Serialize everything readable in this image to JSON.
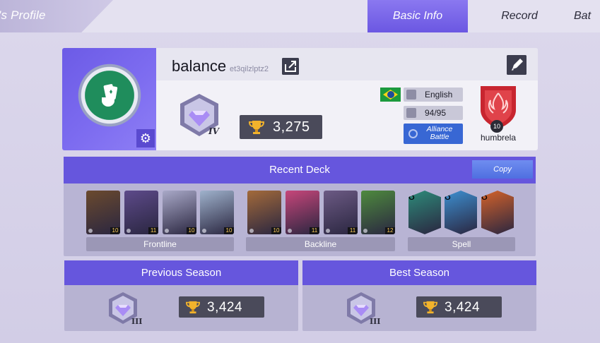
{
  "header": {
    "title": "'s Profile",
    "tabs": [
      {
        "label": "Basic Info",
        "active": true
      },
      {
        "label": "Record",
        "active": false
      },
      {
        "label": "Bat",
        "active": false
      }
    ]
  },
  "profile": {
    "name": "balance",
    "id": "et3qilzlptz2",
    "rank_tier": "IV",
    "trophies": "3,275",
    "language": "English",
    "level_progress": "94/95",
    "alliance_label": "Alliance Battle",
    "guild_level": "10",
    "guild_name": "humbrela",
    "colors": {
      "accent": "#6656dd",
      "flag_green": "#1c9a3d",
      "alliance_blue": "#3867d4"
    }
  },
  "recent_deck": {
    "title": "Recent Deck",
    "copy_label": "Copy",
    "groups": [
      {
        "label": "Frontline",
        "cards": [
          {
            "name": "bear-hero",
            "level": "10",
            "color": "#6b4a2e"
          },
          {
            "name": "witch-hero",
            "level": "11",
            "color": "#5d4a8a"
          },
          {
            "name": "white-hair-hero",
            "level": "10",
            "color": "#a9a9c8"
          },
          {
            "name": "ice-queen-hero",
            "level": "10",
            "color": "#9fb2cc"
          }
        ]
      },
      {
        "label": "Backline",
        "cards": [
          {
            "name": "straw-hat-hero",
            "level": "10",
            "color": "#a36a3a"
          },
          {
            "name": "pink-hair-hero",
            "level": "11",
            "color": "#c7467a"
          },
          {
            "name": "dark-mage-hero",
            "level": "11",
            "color": "#6c5a84"
          },
          {
            "name": "elf-archer-hero",
            "level": "12",
            "color": "#4e8a3e"
          }
        ]
      },
      {
        "label": "Spell",
        "cards": [
          {
            "name": "green-spell",
            "level": "8",
            "color": "#2e8b7a"
          },
          {
            "name": "blue-spell",
            "level": "8",
            "color": "#3d8fd0"
          },
          {
            "name": "fire-spell",
            "level": "8",
            "color": "#d4622a"
          }
        ]
      }
    ]
  },
  "seasons": {
    "previous": {
      "title": "Previous Season",
      "tier": "III",
      "trophies": "3,424"
    },
    "best": {
      "title": "Best Season",
      "tier": "III",
      "trophies": "3,424"
    }
  }
}
